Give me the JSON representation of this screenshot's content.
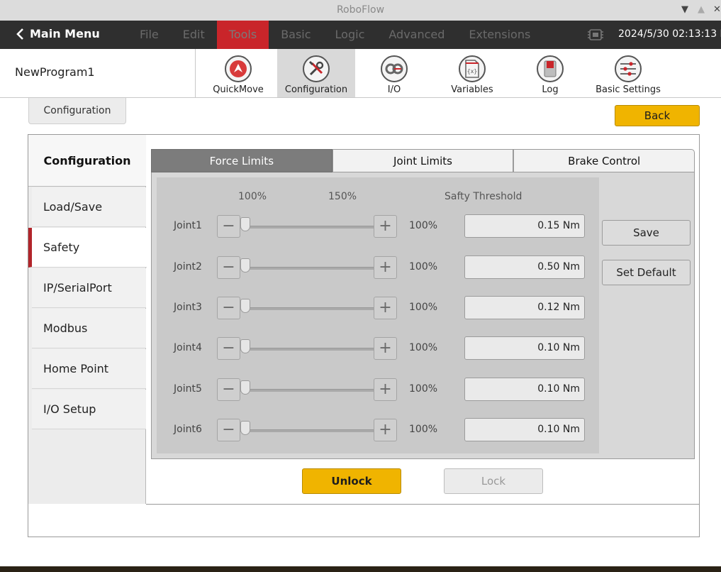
{
  "window": {
    "title": "RoboFlow"
  },
  "menubar": {
    "main_menu": "Main Menu",
    "items": [
      "File",
      "Edit",
      "Tools",
      "Basic",
      "Logic",
      "Advanced",
      "Extensions"
    ],
    "active_item": "Tools",
    "datetime": "2024/5/30 02:13:13 PM"
  },
  "program": {
    "name": "NewProgram1"
  },
  "toolbar": {
    "tools": [
      {
        "label": "QuickMove",
        "icon": "quickmove-icon"
      },
      {
        "label": "Configuration",
        "icon": "wrench-screwdriver-icon"
      },
      {
        "label": "I/O",
        "icon": "io-icon"
      },
      {
        "label": "Variables",
        "icon": "variables-icon"
      },
      {
        "label": "Log",
        "icon": "log-icon"
      },
      {
        "label": "Basic Settings",
        "icon": "sliders-icon"
      }
    ],
    "active_tool": "Configuration"
  },
  "breadcrumb": "Configuration",
  "back_label": "Back",
  "sidebar": {
    "heading": "Configuration",
    "items": [
      "Load/Save",
      "Safety",
      "IP/SerialPort",
      "Modbus",
      "Home Point",
      "I/O Setup"
    ],
    "active_item": "Safety"
  },
  "tabs": {
    "items": [
      "Force Limits",
      "Joint Limits",
      "Brake Control"
    ],
    "active": "Force Limits"
  },
  "force_limits": {
    "header_min": "100%",
    "header_max": "150%",
    "header_threshold": "Safty Threshold",
    "joints": [
      {
        "name": "Joint1",
        "percent": "100%",
        "threshold": "0.15 Nm"
      },
      {
        "name": "Joint2",
        "percent": "100%",
        "threshold": "0.50 Nm"
      },
      {
        "name": "Joint3",
        "percent": "100%",
        "threshold": "0.12 Nm"
      },
      {
        "name": "Joint4",
        "percent": "100%",
        "threshold": "0.10 Nm"
      },
      {
        "name": "Joint5",
        "percent": "100%",
        "threshold": "0.10 Nm"
      },
      {
        "name": "Joint6",
        "percent": "100%",
        "threshold": "0.10 Nm"
      }
    ],
    "minus_glyph": "−",
    "plus_glyph": "+",
    "save_label": "Save",
    "default_label": "Set Default"
  },
  "unlock_label": "Unlock",
  "lock_label": "Lock",
  "colors": {
    "accent": "#f0b400",
    "menu_active": "#c9252a",
    "sidebar_active": "#b2242a"
  }
}
